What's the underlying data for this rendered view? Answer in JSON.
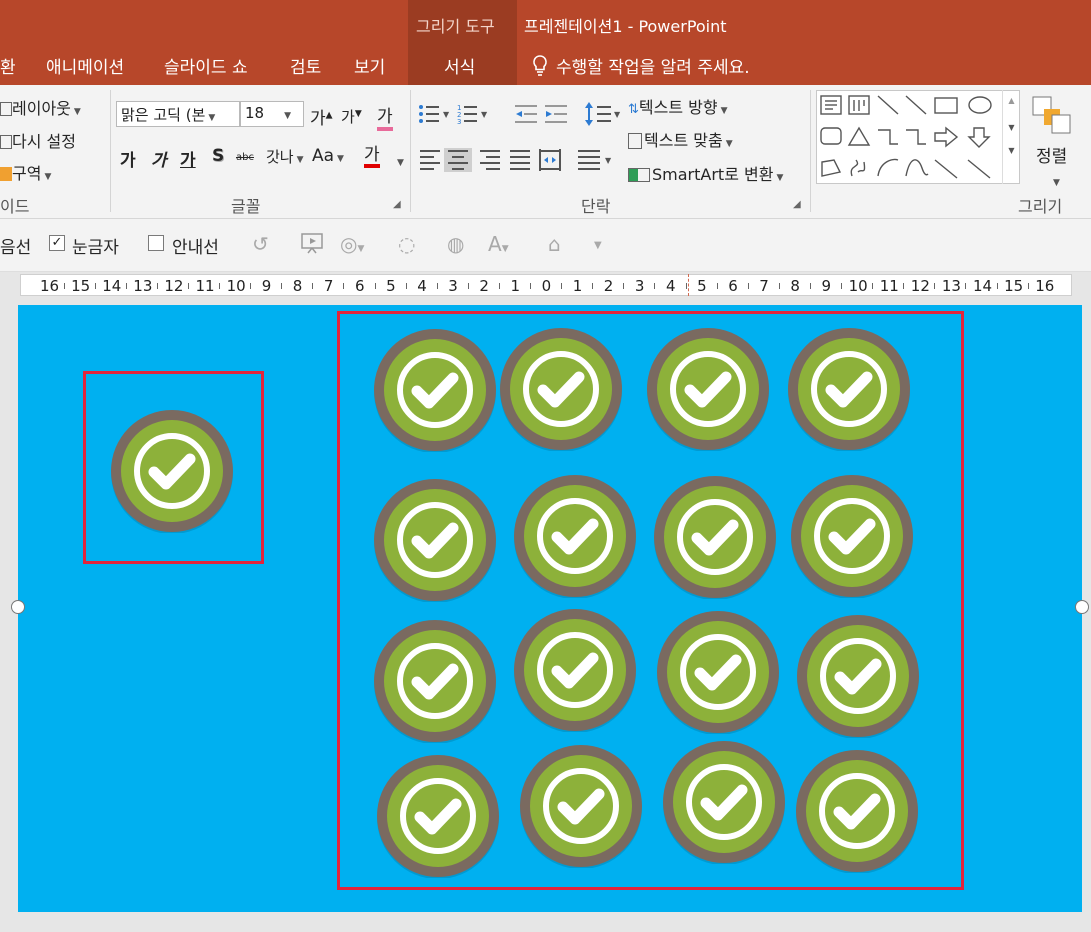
{
  "titlebar": {
    "context_group": "그리기 도구",
    "document_title": "프레젠테이션1 - PowerPoint"
  },
  "tabs": [
    {
      "label": "환"
    },
    {
      "label": "애니메이션"
    },
    {
      "label": "슬라이드 쇼"
    },
    {
      "label": "검토"
    },
    {
      "label": "보기"
    },
    {
      "label": "서식"
    }
  ],
  "tell_me": "수행할 작업을 알려 주세요.",
  "ribbon": {
    "slides": {
      "layout": "레이아웃",
      "reset": "다시 설정",
      "section": "구역",
      "label": "이드"
    },
    "font": {
      "name": "맑은 고딕 (본",
      "size": "18",
      "grow": "가",
      "shrink": "가",
      "clear": "가",
      "bold": "가",
      "italic": "가",
      "underline": "가",
      "shadow": "S",
      "strike": "abc",
      "spacing": "갓나",
      "case": "Aa",
      "color": "가",
      "label": "글꼴"
    },
    "paragraph": {
      "text_direction": "텍스트 방향",
      "align_text": "텍스트 맞춤",
      "smartart": "SmartArt로 변환",
      "label": "단락"
    },
    "drawing": {
      "arrange": "정렬",
      "label": "그리기"
    }
  },
  "quickbar": {
    "gridlines": "음선",
    "ruler": "눈금자",
    "ruler_checked": true,
    "guides": "안내선",
    "guides_checked": false
  },
  "ruler": {
    "labels": [
      "16",
      "15",
      "14",
      "13",
      "12",
      "11",
      "10",
      "9",
      "8",
      "7",
      "6",
      "5",
      "4",
      "3",
      "2",
      "1",
      "0",
      "1",
      "2",
      "3",
      "4",
      "5",
      "6",
      "7",
      "8",
      "9",
      "10",
      "11",
      "12",
      "13",
      "14",
      "15",
      "16"
    ]
  },
  "colors": {
    "title_bar": "#b7472a",
    "context_tab": "#9b3c22",
    "slide_background": "#00b0f0",
    "selection": "#e2243b",
    "badge_ring": "#7a6a60",
    "badge_fill": "#8db13a",
    "badge_check": "#ffffff"
  },
  "slide": {
    "badge_icon": "check-badge-icon",
    "single_group_count": 1,
    "grid_group_rows": 4,
    "grid_group_cols": 4
  }
}
